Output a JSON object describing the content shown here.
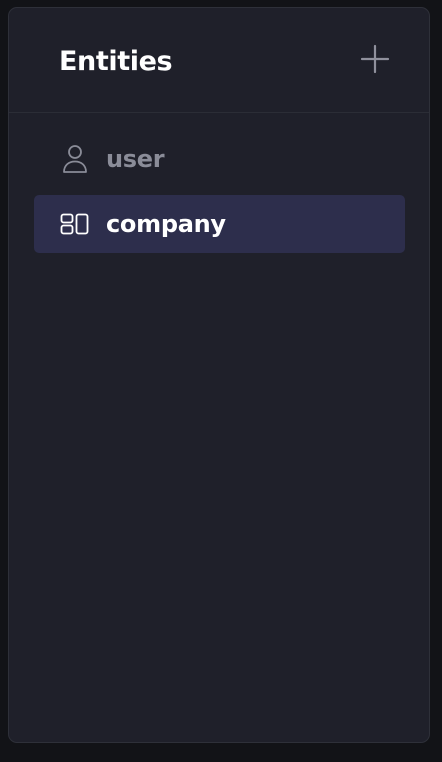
{
  "header": {
    "title": "Entities",
    "add_icon": "plus-icon"
  },
  "entities": [
    {
      "label": "user",
      "icon": "user-icon",
      "selected": false
    },
    {
      "label": "company",
      "icon": "layout-blocks-icon",
      "selected": true
    }
  ],
  "colors": {
    "page_background": "#121317",
    "panel_background": "#1f202a",
    "selected_background": "#2d2e4c",
    "text_primary": "#ffffff",
    "text_muted": "#8a8c98"
  }
}
